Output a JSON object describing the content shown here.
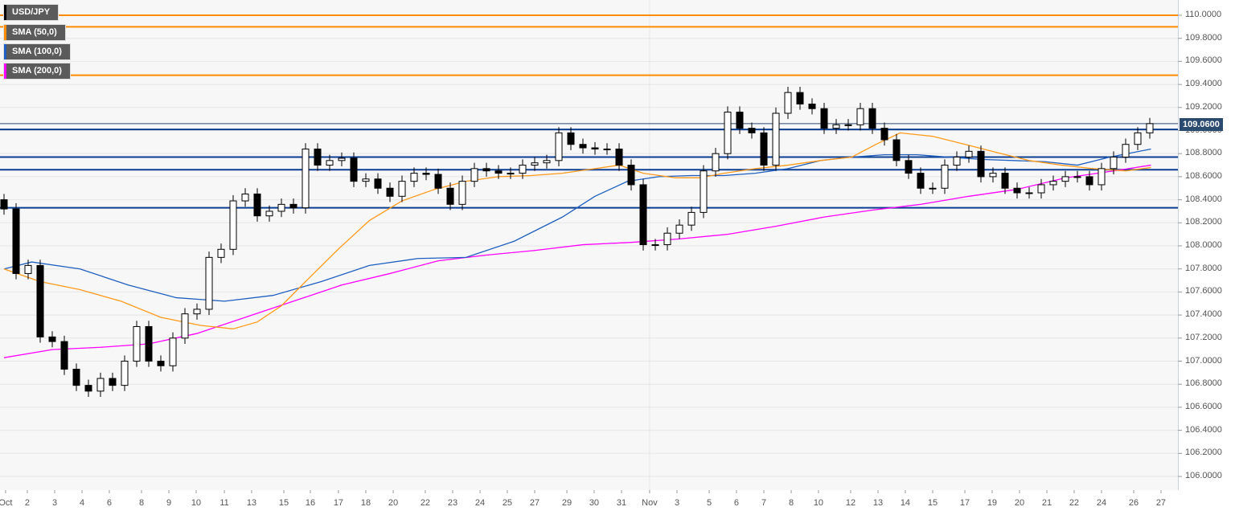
{
  "chart_data": {
    "type": "candlestick",
    "title": "USD/JPY",
    "legend": [
      {
        "label": "USD/JPY",
        "color": "#000000"
      },
      {
        "label": "SMA (50,0)",
        "color": "#ff8c00"
      },
      {
        "label": "SMA (100,0)",
        "color": "#1f5fbf"
      },
      {
        "label": "SMA (200,0)",
        "color": "#ff00ff"
      }
    ],
    "ylim": [
      105.9,
      110.1
    ],
    "y_ticks": [
      "110.0000",
      "109.8000",
      "109.6000",
      "109.4000",
      "109.2000",
      "109.0000",
      "108.8000",
      "108.6000",
      "108.4000",
      "108.2000",
      "108.0000",
      "107.8000",
      "107.6000",
      "107.4000",
      "107.2000",
      "107.0000",
      "106.8000",
      "106.6000",
      "106.4000",
      "106.2000",
      "106.0000"
    ],
    "current_price": "109.0600",
    "resistance_levels": [
      110.0,
      109.9,
      109.48
    ],
    "support_levels": [
      109.01,
      108.77,
      108.66,
      108.33
    ],
    "closes": [
      108.32,
      107.76,
      107.83,
      107.21,
      107.17,
      106.93,
      106.79,
      106.74,
      106.85,
      106.79,
      107.0,
      107.3,
      107.0,
      106.96,
      107.2,
      107.41,
      107.45,
      107.9,
      107.97,
      108.39,
      108.45,
      108.26,
      108.3,
      108.36,
      108.33,
      108.84,
      108.7,
      108.74,
      108.76,
      108.56,
      108.58,
      108.5,
      108.43,
      108.56,
      108.63,
      108.62,
      108.5,
      108.36,
      108.56,
      108.67,
      108.65,
      108.63,
      108.63,
      108.7,
      108.72,
      108.74,
      108.98,
      108.88,
      108.85,
      108.84,
      108.84,
      108.7,
      108.53,
      108.01,
      108.01,
      108.11,
      108.18,
      108.29,
      108.65,
      108.8,
      109.16,
      109.02,
      108.98,
      108.7,
      109.15,
      109.33,
      109.23,
      109.19,
      109.02,
      109.05,
      109.05,
      109.19,
      109.02,
      108.92,
      108.74,
      108.63,
      108.5,
      108.5,
      108.7,
      108.77,
      108.82,
      108.6,
      108.63,
      108.5,
      108.46,
      108.46,
      108.53,
      108.56,
      108.6,
      108.6,
      108.53,
      108.67,
      108.77,
      108.88,
      108.98,
      109.06
    ],
    "first_open": 108.4,
    "sma50": [
      [
        0,
        107.8
      ],
      [
        3,
        107.69
      ],
      [
        6.3,
        107.62
      ],
      [
        9.7,
        107.52
      ],
      [
        13,
        107.38
      ],
      [
        16.3,
        107.31
      ],
      [
        19,
        107.28
      ],
      [
        21,
        107.34
      ],
      [
        23,
        107.48
      ],
      [
        25,
        107.69
      ],
      [
        27.7,
        107.97
      ],
      [
        30.3,
        108.22
      ],
      [
        33,
        108.39
      ],
      [
        35.7,
        108.49
      ],
      [
        38.3,
        108.56
      ],
      [
        41,
        108.6
      ],
      [
        43.7,
        108.61
      ],
      [
        46.3,
        108.63
      ],
      [
        49,
        108.67
      ],
      [
        51,
        108.7
      ],
      [
        53,
        108.63
      ],
      [
        55.7,
        108.59
      ],
      [
        57.7,
        108.59
      ],
      [
        59.7,
        108.63
      ],
      [
        62.3,
        108.67
      ],
      [
        65,
        108.7
      ],
      [
        67.7,
        108.74
      ],
      [
        70.3,
        108.77
      ],
      [
        72.3,
        108.88
      ],
      [
        74.3,
        108.98
      ],
      [
        77,
        108.95
      ],
      [
        79.7,
        108.88
      ],
      [
        82.3,
        108.81
      ],
      [
        85,
        108.74
      ],
      [
        87.7,
        108.7
      ],
      [
        90.3,
        108.67
      ],
      [
        93,
        108.65
      ],
      [
        95.1,
        108.68
      ]
    ],
    "sma100": [
      [
        0,
        107.8
      ],
      [
        2.3,
        107.86
      ],
      [
        6.3,
        107.8
      ],
      [
        10.3,
        107.66
      ],
      [
        14.3,
        107.55
      ],
      [
        18.3,
        107.52
      ],
      [
        22.3,
        107.57
      ],
      [
        26.3,
        107.69
      ],
      [
        30.3,
        107.83
      ],
      [
        34.3,
        107.89
      ],
      [
        38.3,
        107.9
      ],
      [
        42.3,
        108.04
      ],
      [
        46.3,
        108.25
      ],
      [
        49,
        108.43
      ],
      [
        51.7,
        108.56
      ],
      [
        54.3,
        108.6
      ],
      [
        57,
        108.61
      ],
      [
        59.7,
        108.61
      ],
      [
        62.3,
        108.63
      ],
      [
        65,
        108.67
      ],
      [
        67.7,
        108.74
      ],
      [
        70.3,
        108.77
      ],
      [
        73,
        108.79
      ],
      [
        75.7,
        108.79
      ],
      [
        78.3,
        108.77
      ],
      [
        81,
        108.75
      ],
      [
        83.7,
        108.74
      ],
      [
        86.3,
        108.73
      ],
      [
        89,
        108.7
      ],
      [
        91.7,
        108.77
      ],
      [
        95.1,
        108.84
      ]
    ],
    "sma200": [
      [
        0,
        107.03
      ],
      [
        4,
        107.1
      ],
      [
        8,
        107.12
      ],
      [
        12,
        107.15
      ],
      [
        16,
        107.24
      ],
      [
        20,
        107.38
      ],
      [
        24,
        107.52
      ],
      [
        28,
        107.66
      ],
      [
        32,
        107.76
      ],
      [
        36,
        107.87
      ],
      [
        40,
        107.92
      ],
      [
        44,
        107.96
      ],
      [
        48,
        108.01
      ],
      [
        52,
        108.03
      ],
      [
        56,
        108.06
      ],
      [
        60,
        108.1
      ],
      [
        64,
        108.17
      ],
      [
        68,
        108.25
      ],
      [
        72,
        108.31
      ],
      [
        76,
        108.36
      ],
      [
        80,
        108.43
      ],
      [
        84,
        108.49
      ],
      [
        88,
        108.59
      ],
      [
        92,
        108.65
      ],
      [
        95.1,
        108.7
      ]
    ],
    "x_ticks": [
      {
        "label": "Oct",
        "i": 0.13
      },
      {
        "label": "2",
        "i": 1.93
      },
      {
        "label": "3",
        "i": 4.2
      },
      {
        "label": "4",
        "i": 6.47
      },
      {
        "label": "6",
        "i": 8.73
      },
      {
        "label": "8",
        "i": 11.4
      },
      {
        "label": "9",
        "i": 13.67
      },
      {
        "label": "10",
        "i": 15.93
      },
      {
        "label": "11",
        "i": 18.27
      },
      {
        "label": "13",
        "i": 20.53
      },
      {
        "label": "15",
        "i": 23.2
      },
      {
        "label": "16",
        "i": 25.4
      },
      {
        "label": "17",
        "i": 27.73
      },
      {
        "label": "18",
        "i": 30
      },
      {
        "label": "20",
        "i": 32.27
      },
      {
        "label": "22",
        "i": 34.93
      },
      {
        "label": "23",
        "i": 37.2
      },
      {
        "label": "24",
        "i": 39.47
      },
      {
        "label": "25",
        "i": 41.73
      },
      {
        "label": "27",
        "i": 44
      },
      {
        "label": "29",
        "i": 46.67
      },
      {
        "label": "30",
        "i": 48.93
      },
      {
        "label": "31",
        "i": 51.2
      },
      {
        "label": "Nov",
        "i": 53.53
      },
      {
        "label": "3",
        "i": 55.8
      },
      {
        "label": "5",
        "i": 58.47
      },
      {
        "label": "6",
        "i": 60.73
      },
      {
        "label": "7",
        "i": 63
      },
      {
        "label": "8",
        "i": 65.27
      },
      {
        "label": "10",
        "i": 67.53
      },
      {
        "label": "12",
        "i": 70.2
      },
      {
        "label": "13",
        "i": 72.47
      },
      {
        "label": "14",
        "i": 74.73
      },
      {
        "label": "15",
        "i": 77
      },
      {
        "label": "17",
        "i": 79.67
      },
      {
        "label": "19",
        "i": 81.93
      },
      {
        "label": "20",
        "i": 84.2
      },
      {
        "label": "21",
        "i": 86.47
      },
      {
        "label": "22",
        "i": 88.73
      },
      {
        "label": "24",
        "i": 91
      },
      {
        "label": "26",
        "i": 93.67
      },
      {
        "label": "27",
        "i": 95.93
      }
    ]
  }
}
